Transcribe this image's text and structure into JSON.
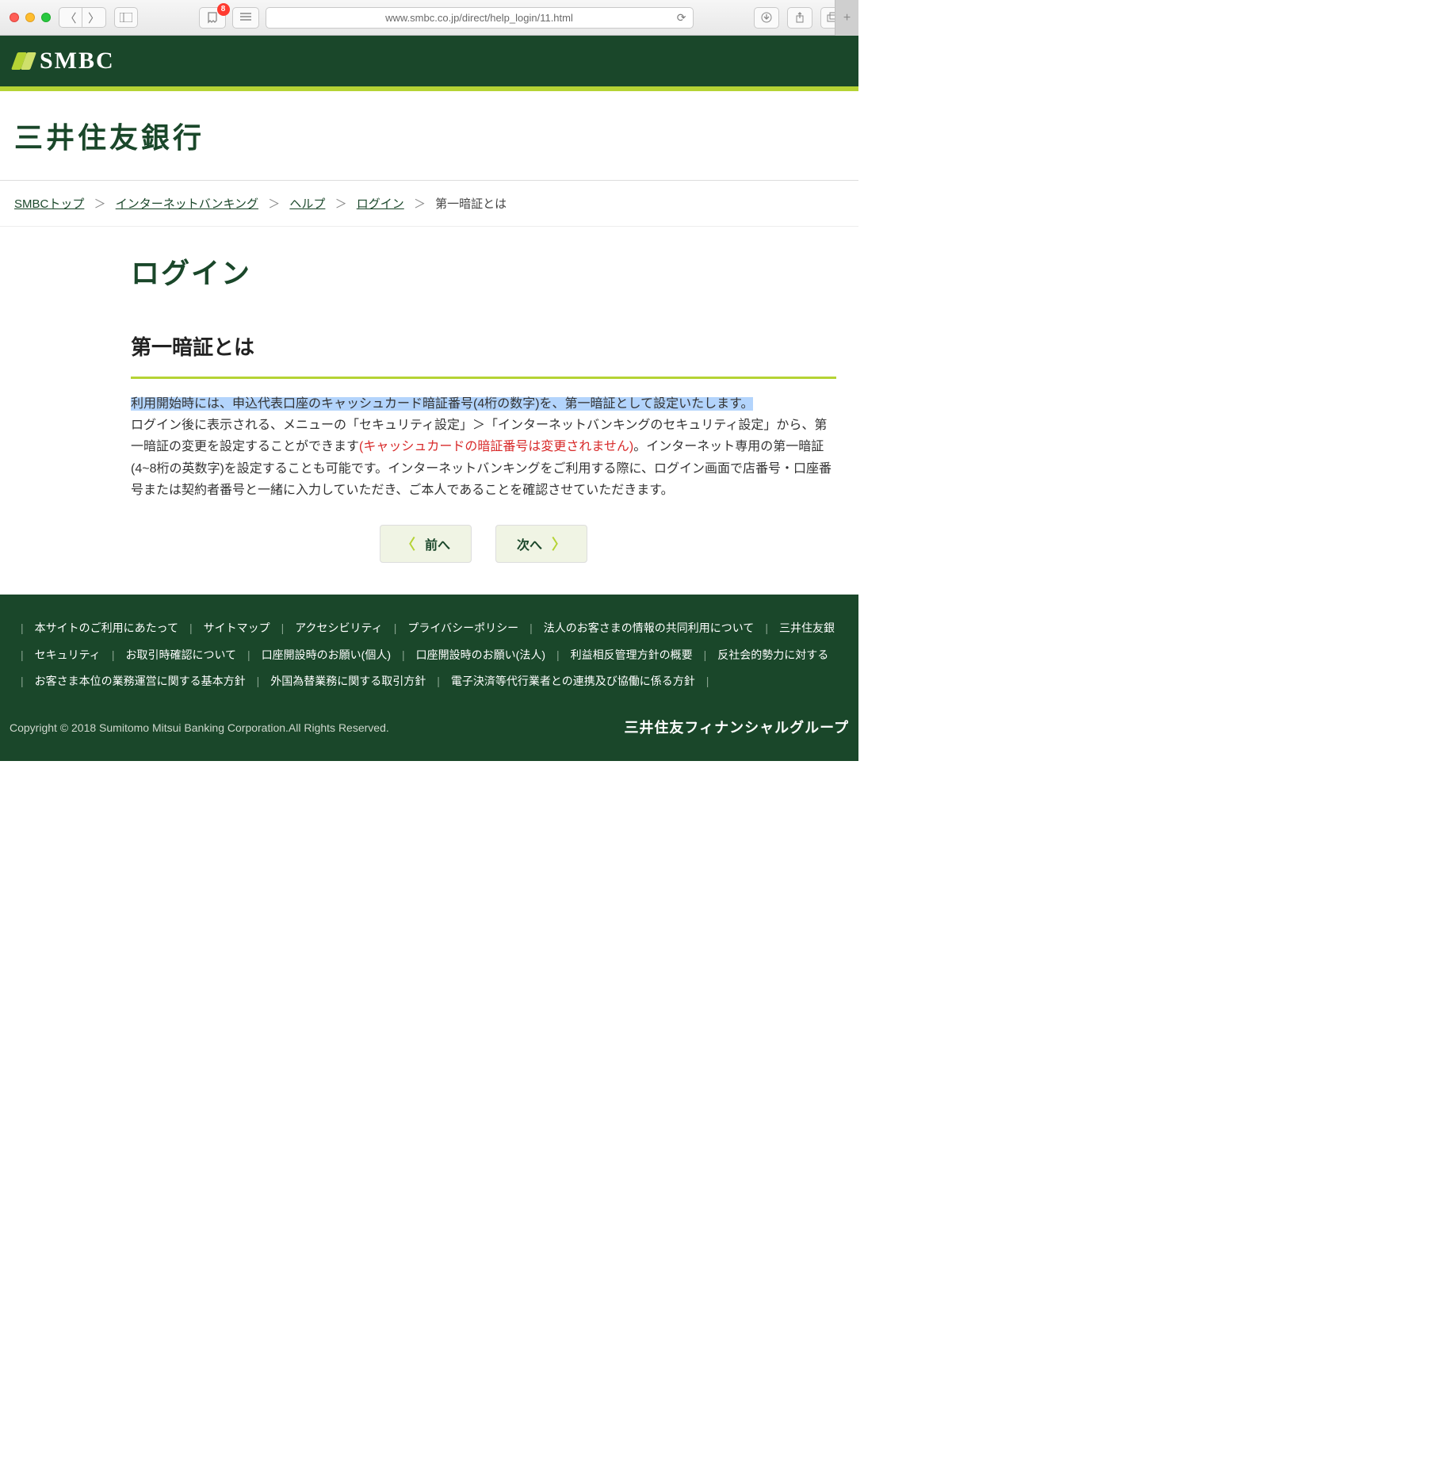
{
  "browser": {
    "url": "www.smbc.co.jp/direct/help_login/11.html",
    "badge_count": "8"
  },
  "header": {
    "logo_text": "SMBC"
  },
  "bank_name": "三井住友銀行",
  "breadcrumb": {
    "items": [
      {
        "label": "SMBCトップ",
        "link": true
      },
      {
        "label": "インターネットバンキング",
        "link": true
      },
      {
        "label": "ヘルプ",
        "link": true
      },
      {
        "label": "ログイン",
        "link": true
      }
    ],
    "current": "第一暗証とは",
    "sep": "＞"
  },
  "page_title": "ログイン",
  "section_title": "第一暗証とは",
  "body": {
    "highlighted": "利用開始時には、申込代表口座のキャッシュカード暗証番号(4桁の数字)を、第一暗証として設定いたします。",
    "line2a": "ログイン後に表示される、メニューの「セキュリティ設定」＞「インターネットバンキングのセキュリティ設定」から、第一暗証の変更を設定することができます",
    "red_note": "(キャッシュカードの暗証番号は変更されません)",
    "line2b": "。インターネット専用の第一暗証(4~8桁の英数字)を設定することも可能です。インターネットバンキングをご利用する際に、ログイン画面で店番号・口座番号または契約者番号と一緒に入力していただき、ご本人であることを確認させていただきます。"
  },
  "buttons": {
    "prev": "前へ",
    "next": "次へ"
  },
  "footer": {
    "links_row1": [
      "本サイトのご利用にあたって",
      "サイトマップ",
      "アクセシビリティ",
      "プライバシーポリシー",
      "法人のお客さまの情報の共同利用について",
      "三井住友銀"
    ],
    "links_row2": [
      "セキュリティ",
      "お取引時確認について",
      "口座開設時のお願い(個人)",
      "口座開設時のお願い(法人)",
      "利益相反管理方針の概要",
      "反社会的勢力に対する"
    ],
    "links_row3": [
      "お客さま本位の業務運営に関する基本方針",
      "外国為替業務に関する取引方針",
      "電子決済等代行業者との連携及び協働に係る方針"
    ],
    "copyright": "Copyright © 2018 Sumitomo Mitsui Banking Corporation.All Rights Reserved.",
    "group_name": "三井住友フィナンシャルグループ"
  }
}
